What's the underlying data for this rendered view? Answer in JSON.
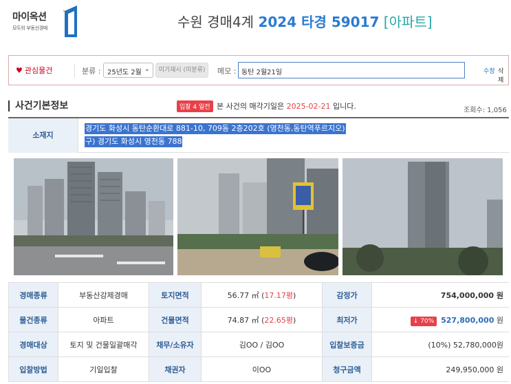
{
  "header": {
    "logo_text": "마이옥션",
    "logo_sub": "모두의 부동산경매",
    "court": "수원 경매4계",
    "case_number": "2024 타경 59017",
    "property_type": "[아파트]"
  },
  "interest": {
    "heart_label": "관심물건",
    "category_label": "분류 :",
    "category_value": "25년도 2월",
    "reauction_button": "미기재시 (미분류)",
    "memo_label": "메모 :",
    "memo_value": "동탄 2월21일",
    "edit_link": "수정",
    "delete_link": "삭제"
  },
  "basic": {
    "title": "사건기본정보",
    "badge": "입찰 4 일전",
    "sale_prefix": "본 사건의 매각기일은",
    "sale_date": "2025-02-21",
    "sale_suffix": "입니다.",
    "views": "조회수: 1,056"
  },
  "address": {
    "label": "소재지",
    "line1": "경기도 화성시 동탄순환대로 881-10, 709동 2층202호 (영천동,동탄역푸르지오)",
    "line2": "구) 경기도 화성시 영천동 788"
  },
  "table": {
    "r1": {
      "l1": "경매종류",
      "v1": "부동산강제경매",
      "l2": "토지면적",
      "v2a": "56.77 ㎡ (",
      "v2b": "17.17평",
      "v2c": ")",
      "l3": "감정가",
      "v3": "754,000,000 원"
    },
    "r2": {
      "l1": "물건종류",
      "v1": "아파트",
      "l2": "건물면적",
      "v2a": "74.87 ㎡ (",
      "v2b": "22.65평",
      "v2c": ")",
      "l3": "최저가",
      "badge": "↓ 70%",
      "v3a": "527,800,000",
      "v3b": " 원"
    },
    "r3": {
      "l1": "경매대상",
      "v1": "토지 및 건물일괄매각",
      "l2": "채무/소유자",
      "v2": "김OO / 김OO",
      "l3": "입찰보증금",
      "v3": "(10%) 52,780,000원"
    },
    "r4": {
      "l1": "입찰방법",
      "v1": "기일입찰",
      "l2": "채권자",
      "v2": "이OO",
      "l3": "청구금액",
      "v3": "249,950,000 원"
    }
  },
  "colors": {
    "accent_blue": "#2b7bd0",
    "red": "#e8404a",
    "teal": "#27a6a9",
    "label_bg": "#eaf0f7"
  }
}
